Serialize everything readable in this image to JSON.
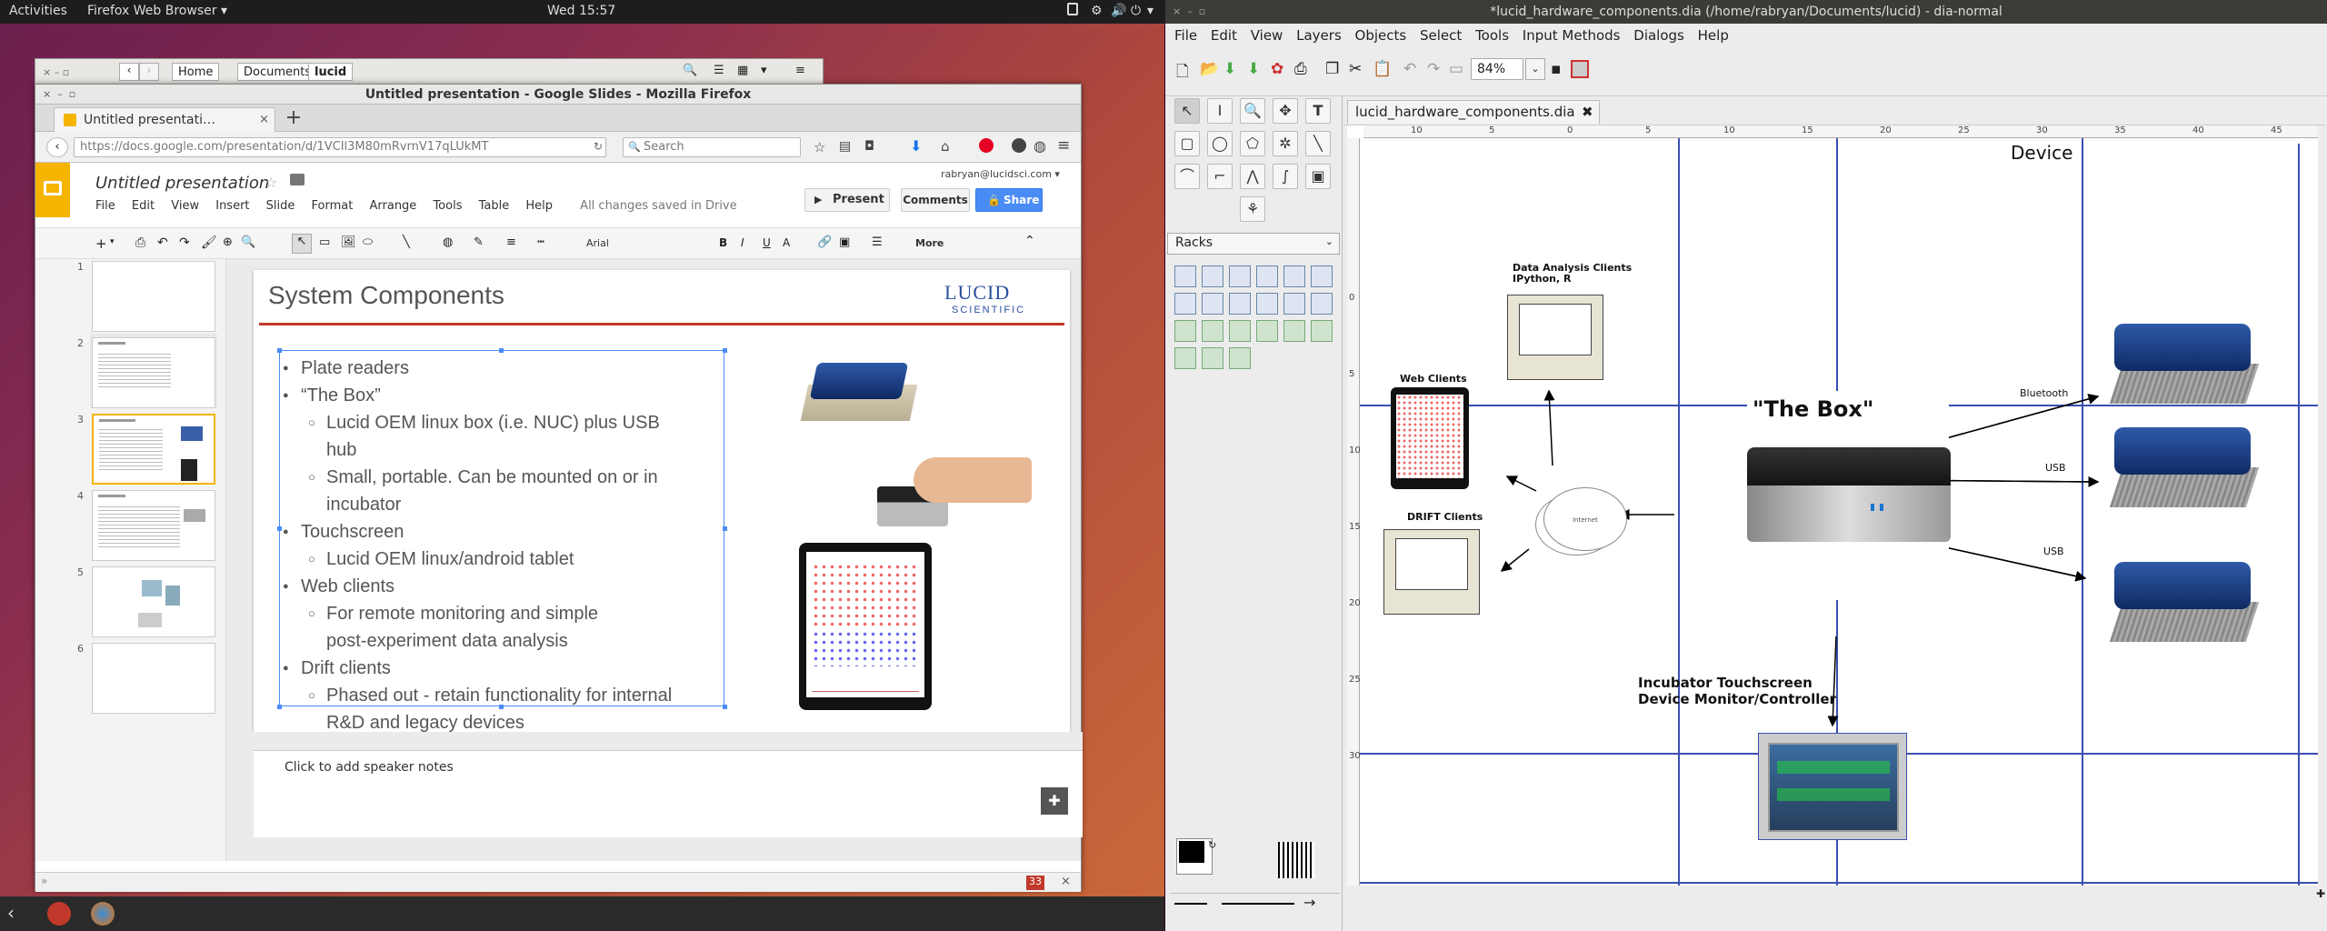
{
  "topbar": {
    "activities": "Activities",
    "app": "Firefox Web Browser ▾",
    "clock": "Wed 15:57"
  },
  "filemanager": {
    "crumbs": [
      "Home",
      "Documents",
      "lucid"
    ]
  },
  "firefox": {
    "title": "Untitled presentation - Google Slides - Mozilla Firefox",
    "tab_label": "Untitled presentati…",
    "url": "https://docs.google.com/presentation/d/1VCIl3M80mRvrnV17qLUkMT",
    "search_placeholder": "Search"
  },
  "slides": {
    "doc_title": "Untitled presentation",
    "account": "rabryan@lucidsci.com ▾",
    "menu": [
      "File",
      "Edit",
      "View",
      "Insert",
      "Slide",
      "Format",
      "Arrange",
      "Tools",
      "Table",
      "Help"
    ],
    "save_status": "All changes saved in Drive",
    "present": "Present",
    "comments": "Comments",
    "share": "Share",
    "font": "Arial",
    "more": "More",
    "thumb_numbers": [
      "1",
      "2",
      "3",
      "4",
      "5",
      "6"
    ],
    "slide_title": "System Components",
    "logo_line1": "LUCID",
    "logo_line2": "SCIENTIFIC",
    "bullets": [
      {
        "text": "Plate readers",
        "level": 1
      },
      {
        "text": "“The Box”",
        "level": 1
      },
      {
        "text": "Lucid OEM linux box (i.e. NUC) plus USB",
        "level": 2
      },
      {
        "text": "hub",
        "level": 3
      },
      {
        "text": "Small, portable.  Can be mounted on or in",
        "level": 2
      },
      {
        "text": "incubator",
        "level": 3
      },
      {
        "text": "Touchscreen",
        "level": 1
      },
      {
        "text": "Lucid OEM linux/android tablet",
        "level": 2
      },
      {
        "text": "Web clients",
        "level": 1
      },
      {
        "text": "For remote monitoring and simple",
        "level": 2
      },
      {
        "text": "post-experiment data analysis",
        "level": 3
      },
      {
        "text": "Drift clients",
        "level": 1
      },
      {
        "text": "Phased out - retain functionality for internal",
        "level": 2
      },
      {
        "text": "R&D and legacy devices",
        "level": 3
      },
      {
        "text": "post-experiment data analysis",
        "level": 1
      }
    ],
    "speaker_notes": "Click to add speaker notes",
    "badge": "33"
  },
  "dia": {
    "title": "*lucid_hardware_components.dia (/home/rabryan/Documents/lucid) - dia-normal",
    "menu": [
      "File",
      "Edit",
      "View",
      "Layers",
      "Objects",
      "Select",
      "Tools",
      "Input Methods",
      "Dialogs",
      "Help"
    ],
    "zoom": "84%",
    "tab": "lucid_hardware_components.dia",
    "sheet": "Racks",
    "ruler_h": [
      "10",
      "5",
      "0",
      "5",
      "10",
      "15",
      "20",
      "25",
      "30",
      "35",
      "40",
      "45"
    ],
    "ruler_v": [
      "0",
      "5",
      "10",
      "15",
      "20",
      "25",
      "30"
    ],
    "diagram": {
      "device": "Device",
      "box": "\"The Box\"",
      "data_analysis": "Data Analysis Clients",
      "ipython": "IPython, R",
      "web_clients": "Web Clients",
      "drift_clients": "DRIFT Clients",
      "internet": "Internet",
      "bluetooth": "Bluetooth",
      "usb1": "USB",
      "usb2": "USB",
      "incubator1": "Incubator Touchscreen",
      "incubator2": "Device Monitor/Controller"
    }
  }
}
